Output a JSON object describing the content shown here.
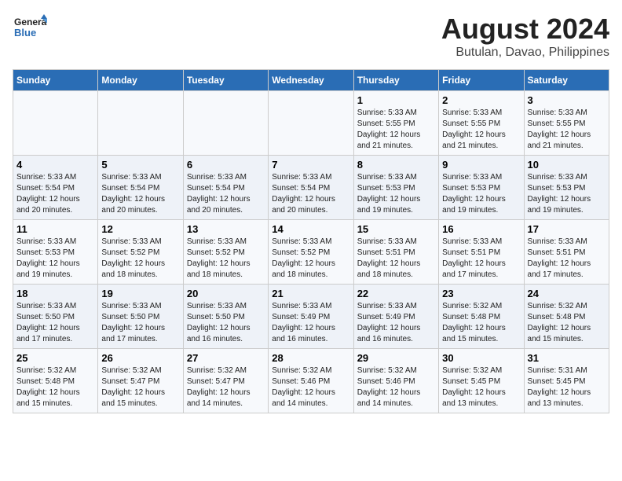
{
  "header": {
    "logo_text_general": "General",
    "logo_text_blue": "Blue",
    "title": "August 2024",
    "subtitle": "Butulan, Davao, Philippines"
  },
  "days_of_week": [
    "Sunday",
    "Monday",
    "Tuesday",
    "Wednesday",
    "Thursday",
    "Friday",
    "Saturday"
  ],
  "weeks": [
    [
      {
        "day": "",
        "info": ""
      },
      {
        "day": "",
        "info": ""
      },
      {
        "day": "",
        "info": ""
      },
      {
        "day": "",
        "info": ""
      },
      {
        "day": "1",
        "info": "Sunrise: 5:33 AM\nSunset: 5:55 PM\nDaylight: 12 hours\nand 21 minutes."
      },
      {
        "day": "2",
        "info": "Sunrise: 5:33 AM\nSunset: 5:55 PM\nDaylight: 12 hours\nand 21 minutes."
      },
      {
        "day": "3",
        "info": "Sunrise: 5:33 AM\nSunset: 5:55 PM\nDaylight: 12 hours\nand 21 minutes."
      }
    ],
    [
      {
        "day": "4",
        "info": "Sunrise: 5:33 AM\nSunset: 5:54 PM\nDaylight: 12 hours\nand 20 minutes."
      },
      {
        "day": "5",
        "info": "Sunrise: 5:33 AM\nSunset: 5:54 PM\nDaylight: 12 hours\nand 20 minutes."
      },
      {
        "day": "6",
        "info": "Sunrise: 5:33 AM\nSunset: 5:54 PM\nDaylight: 12 hours\nand 20 minutes."
      },
      {
        "day": "7",
        "info": "Sunrise: 5:33 AM\nSunset: 5:54 PM\nDaylight: 12 hours\nand 20 minutes."
      },
      {
        "day": "8",
        "info": "Sunrise: 5:33 AM\nSunset: 5:53 PM\nDaylight: 12 hours\nand 19 minutes."
      },
      {
        "day": "9",
        "info": "Sunrise: 5:33 AM\nSunset: 5:53 PM\nDaylight: 12 hours\nand 19 minutes."
      },
      {
        "day": "10",
        "info": "Sunrise: 5:33 AM\nSunset: 5:53 PM\nDaylight: 12 hours\nand 19 minutes."
      }
    ],
    [
      {
        "day": "11",
        "info": "Sunrise: 5:33 AM\nSunset: 5:53 PM\nDaylight: 12 hours\nand 19 minutes."
      },
      {
        "day": "12",
        "info": "Sunrise: 5:33 AM\nSunset: 5:52 PM\nDaylight: 12 hours\nand 18 minutes."
      },
      {
        "day": "13",
        "info": "Sunrise: 5:33 AM\nSunset: 5:52 PM\nDaylight: 12 hours\nand 18 minutes."
      },
      {
        "day": "14",
        "info": "Sunrise: 5:33 AM\nSunset: 5:52 PM\nDaylight: 12 hours\nand 18 minutes."
      },
      {
        "day": "15",
        "info": "Sunrise: 5:33 AM\nSunset: 5:51 PM\nDaylight: 12 hours\nand 18 minutes."
      },
      {
        "day": "16",
        "info": "Sunrise: 5:33 AM\nSunset: 5:51 PM\nDaylight: 12 hours\nand 17 minutes."
      },
      {
        "day": "17",
        "info": "Sunrise: 5:33 AM\nSunset: 5:51 PM\nDaylight: 12 hours\nand 17 minutes."
      }
    ],
    [
      {
        "day": "18",
        "info": "Sunrise: 5:33 AM\nSunset: 5:50 PM\nDaylight: 12 hours\nand 17 minutes."
      },
      {
        "day": "19",
        "info": "Sunrise: 5:33 AM\nSunset: 5:50 PM\nDaylight: 12 hours\nand 17 minutes."
      },
      {
        "day": "20",
        "info": "Sunrise: 5:33 AM\nSunset: 5:50 PM\nDaylight: 12 hours\nand 16 minutes."
      },
      {
        "day": "21",
        "info": "Sunrise: 5:33 AM\nSunset: 5:49 PM\nDaylight: 12 hours\nand 16 minutes."
      },
      {
        "day": "22",
        "info": "Sunrise: 5:33 AM\nSunset: 5:49 PM\nDaylight: 12 hours\nand 16 minutes."
      },
      {
        "day": "23",
        "info": "Sunrise: 5:32 AM\nSunset: 5:48 PM\nDaylight: 12 hours\nand 15 minutes."
      },
      {
        "day": "24",
        "info": "Sunrise: 5:32 AM\nSunset: 5:48 PM\nDaylight: 12 hours\nand 15 minutes."
      }
    ],
    [
      {
        "day": "25",
        "info": "Sunrise: 5:32 AM\nSunset: 5:48 PM\nDaylight: 12 hours\nand 15 minutes."
      },
      {
        "day": "26",
        "info": "Sunrise: 5:32 AM\nSunset: 5:47 PM\nDaylight: 12 hours\nand 15 minutes."
      },
      {
        "day": "27",
        "info": "Sunrise: 5:32 AM\nSunset: 5:47 PM\nDaylight: 12 hours\nand 14 minutes."
      },
      {
        "day": "28",
        "info": "Sunrise: 5:32 AM\nSunset: 5:46 PM\nDaylight: 12 hours\nand 14 minutes."
      },
      {
        "day": "29",
        "info": "Sunrise: 5:32 AM\nSunset: 5:46 PM\nDaylight: 12 hours\nand 14 minutes."
      },
      {
        "day": "30",
        "info": "Sunrise: 5:32 AM\nSunset: 5:45 PM\nDaylight: 12 hours\nand 13 minutes."
      },
      {
        "day": "31",
        "info": "Sunrise: 5:31 AM\nSunset: 5:45 PM\nDaylight: 12 hours\nand 13 minutes."
      }
    ]
  ]
}
